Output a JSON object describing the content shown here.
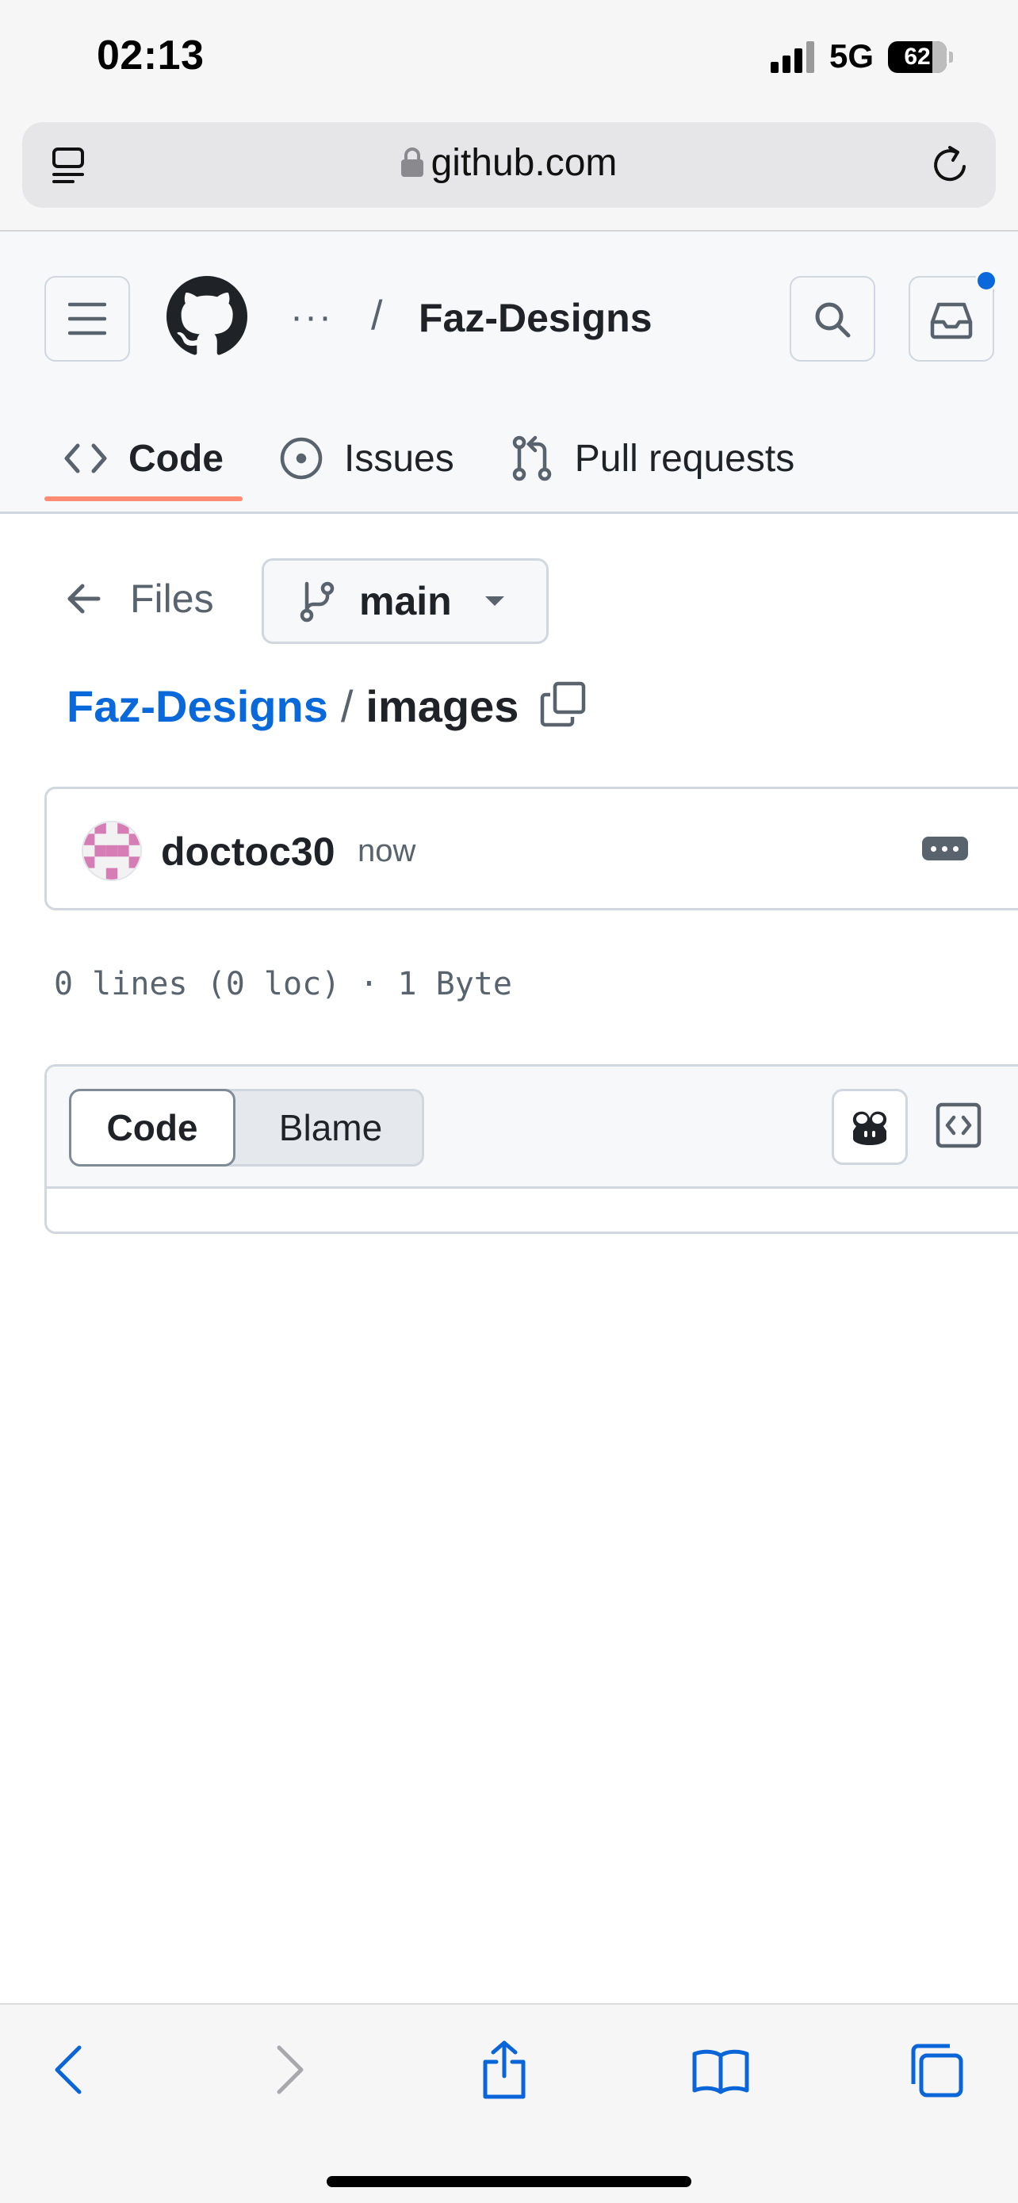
{
  "status_bar": {
    "time": "02:13",
    "network": "5G",
    "battery": "62"
  },
  "browser": {
    "url": "github.com"
  },
  "header": {
    "ellipsis": "···",
    "separator": "/",
    "repo": "Faz-Designs",
    "notification_color": "#0969da"
  },
  "tabs": [
    {
      "label": "Code",
      "icon": "code-icon",
      "active": true
    },
    {
      "label": "Issues",
      "icon": "issue-opened-icon",
      "active": false
    },
    {
      "label": "Pull requests",
      "icon": "git-pull-request-icon",
      "active": false
    }
  ],
  "nav": {
    "files_label": "Files",
    "branch": "main"
  },
  "breadcrumb": {
    "repo": "Faz-Designs",
    "separator": "/",
    "current": "images"
  },
  "commit": {
    "user": "doctoc30",
    "time": "now"
  },
  "file_info": "0 lines (0 loc) · 1 Byte",
  "code_view": {
    "code_label": "Code",
    "blame_label": "Blame"
  },
  "colors": {
    "accent": "#0969da",
    "tab_underline": "#fd8c73",
    "border": "#d0d7de"
  }
}
